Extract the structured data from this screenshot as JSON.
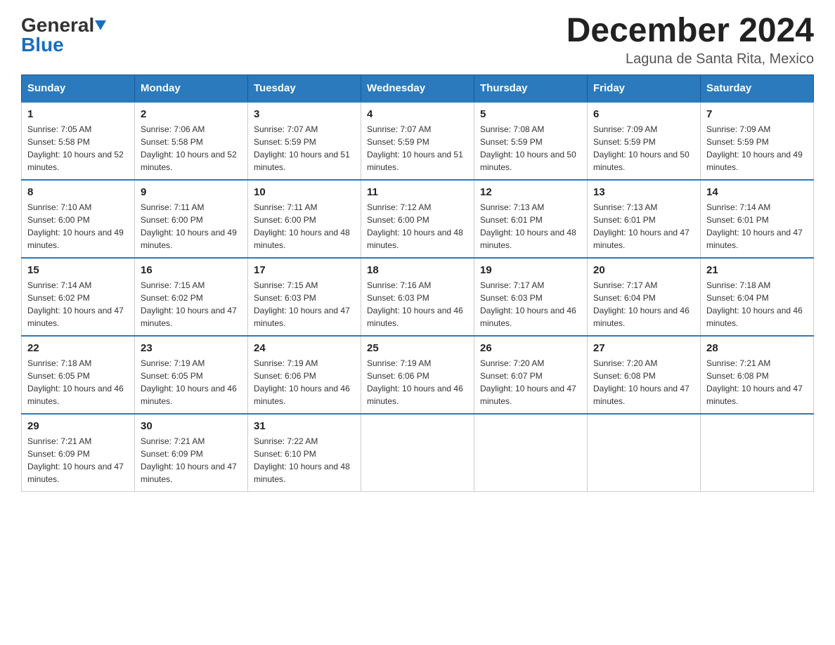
{
  "header": {
    "logo_general": "General",
    "logo_blue": "Blue",
    "month_year": "December 2024",
    "location": "Laguna de Santa Rita, Mexico"
  },
  "columns": [
    "Sunday",
    "Monday",
    "Tuesday",
    "Wednesday",
    "Thursday",
    "Friday",
    "Saturday"
  ],
  "weeks": [
    [
      {
        "day": "1",
        "sunrise": "Sunrise: 7:05 AM",
        "sunset": "Sunset: 5:58 PM",
        "daylight": "Daylight: 10 hours and 52 minutes."
      },
      {
        "day": "2",
        "sunrise": "Sunrise: 7:06 AM",
        "sunset": "Sunset: 5:58 PM",
        "daylight": "Daylight: 10 hours and 52 minutes."
      },
      {
        "day": "3",
        "sunrise": "Sunrise: 7:07 AM",
        "sunset": "Sunset: 5:59 PM",
        "daylight": "Daylight: 10 hours and 51 minutes."
      },
      {
        "day": "4",
        "sunrise": "Sunrise: 7:07 AM",
        "sunset": "Sunset: 5:59 PM",
        "daylight": "Daylight: 10 hours and 51 minutes."
      },
      {
        "day": "5",
        "sunrise": "Sunrise: 7:08 AM",
        "sunset": "Sunset: 5:59 PM",
        "daylight": "Daylight: 10 hours and 50 minutes."
      },
      {
        "day": "6",
        "sunrise": "Sunrise: 7:09 AM",
        "sunset": "Sunset: 5:59 PM",
        "daylight": "Daylight: 10 hours and 50 minutes."
      },
      {
        "day": "7",
        "sunrise": "Sunrise: 7:09 AM",
        "sunset": "Sunset: 5:59 PM",
        "daylight": "Daylight: 10 hours and 49 minutes."
      }
    ],
    [
      {
        "day": "8",
        "sunrise": "Sunrise: 7:10 AM",
        "sunset": "Sunset: 6:00 PM",
        "daylight": "Daylight: 10 hours and 49 minutes."
      },
      {
        "day": "9",
        "sunrise": "Sunrise: 7:11 AM",
        "sunset": "Sunset: 6:00 PM",
        "daylight": "Daylight: 10 hours and 49 minutes."
      },
      {
        "day": "10",
        "sunrise": "Sunrise: 7:11 AM",
        "sunset": "Sunset: 6:00 PM",
        "daylight": "Daylight: 10 hours and 48 minutes."
      },
      {
        "day": "11",
        "sunrise": "Sunrise: 7:12 AM",
        "sunset": "Sunset: 6:00 PM",
        "daylight": "Daylight: 10 hours and 48 minutes."
      },
      {
        "day": "12",
        "sunrise": "Sunrise: 7:13 AM",
        "sunset": "Sunset: 6:01 PM",
        "daylight": "Daylight: 10 hours and 48 minutes."
      },
      {
        "day": "13",
        "sunrise": "Sunrise: 7:13 AM",
        "sunset": "Sunset: 6:01 PM",
        "daylight": "Daylight: 10 hours and 47 minutes."
      },
      {
        "day": "14",
        "sunrise": "Sunrise: 7:14 AM",
        "sunset": "Sunset: 6:01 PM",
        "daylight": "Daylight: 10 hours and 47 minutes."
      }
    ],
    [
      {
        "day": "15",
        "sunrise": "Sunrise: 7:14 AM",
        "sunset": "Sunset: 6:02 PM",
        "daylight": "Daylight: 10 hours and 47 minutes."
      },
      {
        "day": "16",
        "sunrise": "Sunrise: 7:15 AM",
        "sunset": "Sunset: 6:02 PM",
        "daylight": "Daylight: 10 hours and 47 minutes."
      },
      {
        "day": "17",
        "sunrise": "Sunrise: 7:15 AM",
        "sunset": "Sunset: 6:03 PM",
        "daylight": "Daylight: 10 hours and 47 minutes."
      },
      {
        "day": "18",
        "sunrise": "Sunrise: 7:16 AM",
        "sunset": "Sunset: 6:03 PM",
        "daylight": "Daylight: 10 hours and 46 minutes."
      },
      {
        "day": "19",
        "sunrise": "Sunrise: 7:17 AM",
        "sunset": "Sunset: 6:03 PM",
        "daylight": "Daylight: 10 hours and 46 minutes."
      },
      {
        "day": "20",
        "sunrise": "Sunrise: 7:17 AM",
        "sunset": "Sunset: 6:04 PM",
        "daylight": "Daylight: 10 hours and 46 minutes."
      },
      {
        "day": "21",
        "sunrise": "Sunrise: 7:18 AM",
        "sunset": "Sunset: 6:04 PM",
        "daylight": "Daylight: 10 hours and 46 minutes."
      }
    ],
    [
      {
        "day": "22",
        "sunrise": "Sunrise: 7:18 AM",
        "sunset": "Sunset: 6:05 PM",
        "daylight": "Daylight: 10 hours and 46 minutes."
      },
      {
        "day": "23",
        "sunrise": "Sunrise: 7:19 AM",
        "sunset": "Sunset: 6:05 PM",
        "daylight": "Daylight: 10 hours and 46 minutes."
      },
      {
        "day": "24",
        "sunrise": "Sunrise: 7:19 AM",
        "sunset": "Sunset: 6:06 PM",
        "daylight": "Daylight: 10 hours and 46 minutes."
      },
      {
        "day": "25",
        "sunrise": "Sunrise: 7:19 AM",
        "sunset": "Sunset: 6:06 PM",
        "daylight": "Daylight: 10 hours and 46 minutes."
      },
      {
        "day": "26",
        "sunrise": "Sunrise: 7:20 AM",
        "sunset": "Sunset: 6:07 PM",
        "daylight": "Daylight: 10 hours and 47 minutes."
      },
      {
        "day": "27",
        "sunrise": "Sunrise: 7:20 AM",
        "sunset": "Sunset: 6:08 PM",
        "daylight": "Daylight: 10 hours and 47 minutes."
      },
      {
        "day": "28",
        "sunrise": "Sunrise: 7:21 AM",
        "sunset": "Sunset: 6:08 PM",
        "daylight": "Daylight: 10 hours and 47 minutes."
      }
    ],
    [
      {
        "day": "29",
        "sunrise": "Sunrise: 7:21 AM",
        "sunset": "Sunset: 6:09 PM",
        "daylight": "Daylight: 10 hours and 47 minutes."
      },
      {
        "day": "30",
        "sunrise": "Sunrise: 7:21 AM",
        "sunset": "Sunset: 6:09 PM",
        "daylight": "Daylight: 10 hours and 47 minutes."
      },
      {
        "day": "31",
        "sunrise": "Sunrise: 7:22 AM",
        "sunset": "Sunset: 6:10 PM",
        "daylight": "Daylight: 10 hours and 48 minutes."
      },
      null,
      null,
      null,
      null
    ]
  ]
}
